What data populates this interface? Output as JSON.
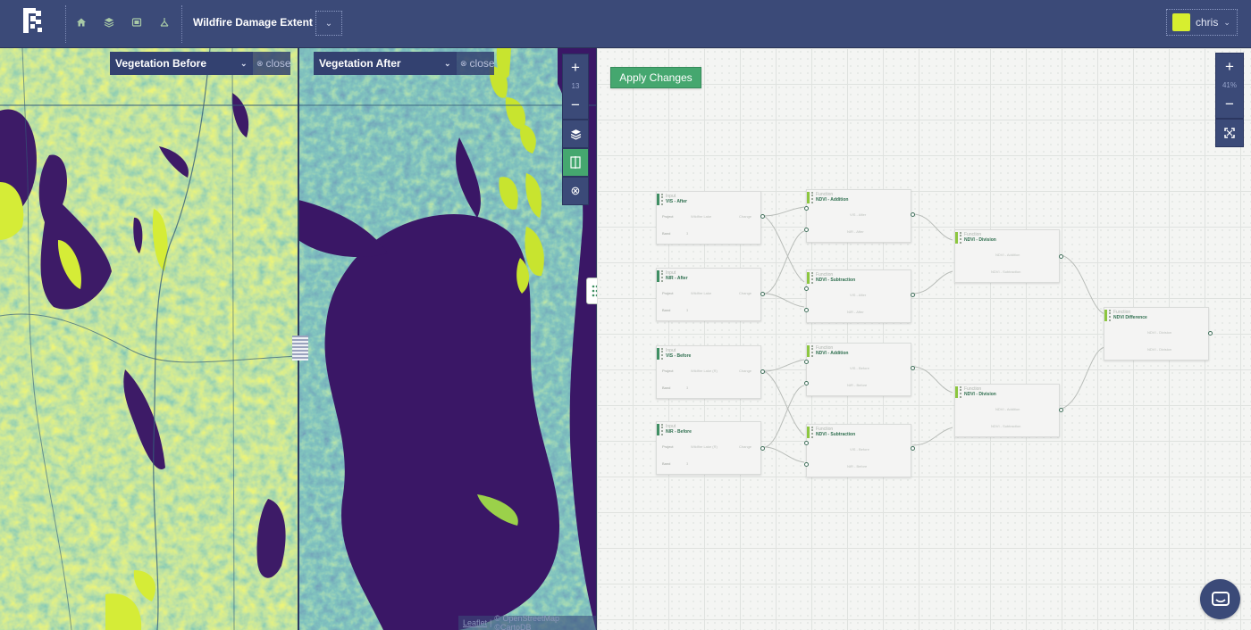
{
  "header": {
    "project_title": "Wildfire Damage Extent",
    "nav": [
      "home-icon",
      "layers-icon",
      "imports-icon",
      "lab-icon"
    ],
    "user": {
      "name": "chris",
      "swatch_color": "#d7ee2f"
    }
  },
  "map": {
    "left_layer": {
      "label": "Vegetation Before",
      "close_label": "close"
    },
    "right_layer": {
      "label": "Vegetation After",
      "close_label": "close"
    },
    "zoom_level": "13",
    "attribution": {
      "leaflet": "Leaflet",
      "sep": "|",
      "credit": "© OpenStreetMap ©CartoDB"
    },
    "colors": {
      "low": "#3d1b67",
      "mid": "#2e7f7c",
      "high": "#d5ec37"
    }
  },
  "lab": {
    "apply_label": "Apply Changes",
    "zoom_percent": "41%",
    "nodes": [
      {
        "type": "Input",
        "title": "VIS - After",
        "row1_label": "Project",
        "row1_value": "Wildfire Lake",
        "row1_action": "Change",
        "row2_label": "Band",
        "row2_value": "3"
      },
      {
        "type": "Input",
        "title": "NIR - After",
        "row1_label": "Project",
        "row1_value": "Wildfire Lake",
        "row1_action": "Change",
        "row2_label": "Band",
        "row2_value": "3"
      },
      {
        "type": "Input",
        "title": "VIS - Before",
        "row1_label": "Project",
        "row1_value": "Wildfire Lake (R)",
        "row1_action": "Change",
        "row2_label": "Band",
        "row2_value": "3"
      },
      {
        "type": "Input",
        "title": "NIR - Before",
        "row1_label": "Project",
        "row1_value": "Wildfire Lake (R)",
        "row1_action": "Change",
        "row2_label": "Band",
        "row2_value": "3"
      },
      {
        "type": "Function",
        "title": "NDVI - Addition",
        "row1_label": "VIS - After",
        "row2_label": "NIR - After"
      },
      {
        "type": "Function",
        "title": "NDVI - Subtraction",
        "row1_label": "VIS - After",
        "row2_label": "NIR - After"
      },
      {
        "type": "Function",
        "title": "NDVI - Addition",
        "row1_label": "VIS - Before",
        "row2_label": "NIR - Before"
      },
      {
        "type": "Function",
        "title": "NDVI - Subtraction",
        "row1_label": "VIS - Before",
        "row2_label": "NIR - Before"
      },
      {
        "type": "Function",
        "title": "NDVI - Division",
        "row1_label": "NDVI - Addition",
        "row2_label": "NDVI - Subtraction"
      },
      {
        "type": "Function",
        "title": "NDVI - Division",
        "row1_label": "NDVI - Addition",
        "row2_label": "NDVI - Subtraction"
      },
      {
        "type": "Function",
        "title": "NDVI Difference",
        "row1_label": "NDVI - Division",
        "row2_label": "NDVI - Division"
      }
    ]
  },
  "chat": {
    "icon": "chat-icon"
  }
}
